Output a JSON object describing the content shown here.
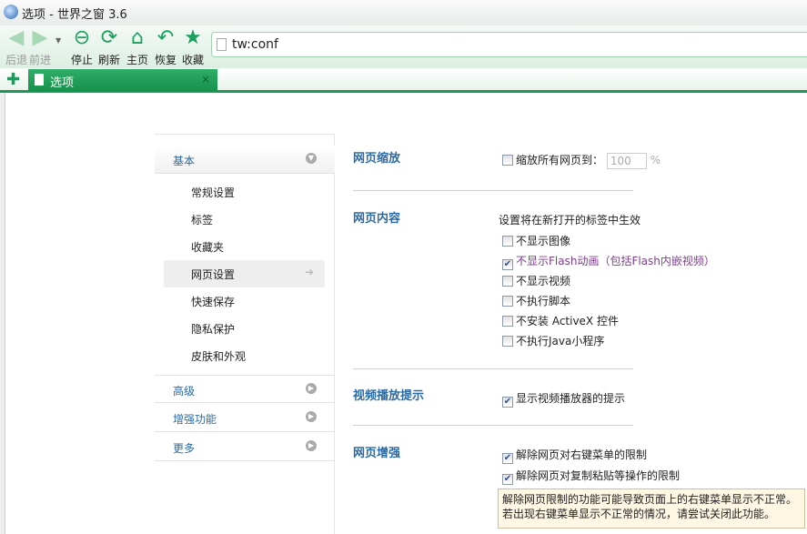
{
  "window": {
    "title": "选项 - 世界之窗 3.6"
  },
  "toolbar": {
    "back": "后退",
    "forward": "前进",
    "stop": "停止",
    "refresh": "刷新",
    "home": "主页",
    "restore": "恢复",
    "favorites": "收藏",
    "address": "tw:conf"
  },
  "tabs": [
    {
      "label": "选项",
      "close": "×"
    }
  ],
  "sidebar": {
    "groups": [
      {
        "label": "基本"
      },
      {
        "label": "高级"
      },
      {
        "label": "增强功能"
      },
      {
        "label": "更多"
      }
    ],
    "items": [
      {
        "label": "常规设置"
      },
      {
        "label": "标签"
      },
      {
        "label": "收藏夹"
      },
      {
        "label": "网页设置",
        "selected": true
      },
      {
        "label": "快速保存"
      },
      {
        "label": "隐私保护"
      },
      {
        "label": "皮肤和外观"
      }
    ]
  },
  "main": {
    "zoom": {
      "title": "网页缩放",
      "label": "缩放所有网页到：",
      "value": "100",
      "unit": "%",
      "checked": false
    },
    "content": {
      "title": "网页内容",
      "note": "设置将在新打开的标签中生效",
      "options": [
        {
          "label": "不显示图像",
          "checked": false
        },
        {
          "label": "不显示Flash动画（包括Flash内嵌视频）",
          "checked": true
        },
        {
          "label": "不显示视频",
          "checked": false
        },
        {
          "label": "不执行脚本",
          "checked": false
        },
        {
          "label": "不安装 ActiveX 控件",
          "checked": false
        },
        {
          "label": "不执行Java小程序",
          "checked": false
        }
      ]
    },
    "video": {
      "title": "视频播放提示",
      "options": [
        {
          "label": "显示视频播放器的提示",
          "checked": true
        }
      ]
    },
    "enhance": {
      "title": "网页增强",
      "options": [
        {
          "label": "解除网页对右键菜单的限制",
          "checked": true
        },
        {
          "label": "解除网页对复制粘贴等操作的限制",
          "checked": true
        }
      ],
      "tip_line1": "解除网页限制的功能可能导致页面上的右键菜单显示不正常。",
      "tip_line2": "若出现右键菜单显示不正常的情况，请尝试关闭此功能。"
    }
  }
}
